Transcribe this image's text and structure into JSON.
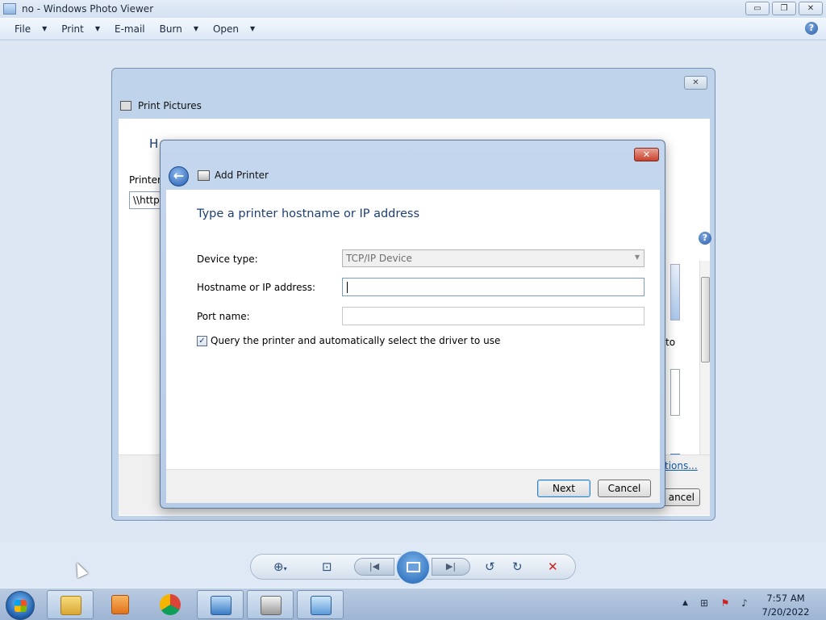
{
  "photo_viewer": {
    "title": "no - Windows Photo Viewer",
    "window_controls": {
      "minimize": "▭",
      "restore": "❐",
      "close": "✕"
    },
    "menu": [
      {
        "label": "File",
        "has_dropdown": true
      },
      {
        "label": "Print",
        "has_dropdown": true
      },
      {
        "label": "E-mail",
        "has_dropdown": false
      },
      {
        "label": "Burn",
        "has_dropdown": true
      },
      {
        "label": "Open",
        "has_dropdown": true
      }
    ],
    "help_glyph": "?"
  },
  "print_pictures": {
    "title": "Print Pictures",
    "heading_partial": "H",
    "printer_label": "Printer:",
    "printer_value": "\\\\https",
    "thumbnail_caption_partial": "to",
    "options_link_partial": "tions...",
    "cancel_partial": "ancel",
    "close_glyph": "✕",
    "help_glyph": "?"
  },
  "add_printer": {
    "title": "Add Printer",
    "close_glyph": "✕",
    "back_glyph": "←",
    "heading": "Type a printer hostname or IP address",
    "device_type_label": "Device type:",
    "device_type_value": "TCP/IP Device",
    "hostname_label": "Hostname or IP address:",
    "hostname_value": "",
    "port_name_label": "Port name:",
    "port_name_value": "",
    "query_checkbox_label": "Query the printer and automatically select the driver to use",
    "query_checked": true,
    "checkmark": "✓",
    "next_label": "Next",
    "cancel_label": "Cancel"
  },
  "viewer_controls": {
    "zoom": "zoom-icon",
    "actual_size": "fit-icon",
    "previous": "previous-icon",
    "slideshow": "slideshow-icon",
    "next": "next-icon",
    "rotate_ccw": "rotate-counterclockwise-icon",
    "rotate_cw": "rotate-clockwise-icon",
    "delete": "delete-icon"
  },
  "taskbar": {
    "pinned": [
      "file-explorer",
      "media-player",
      "chrome",
      "photo-viewer",
      "printer",
      "control-panel"
    ],
    "time": "7:57 AM",
    "date": "7/20/2022",
    "tray_up_glyph": "▲"
  }
}
